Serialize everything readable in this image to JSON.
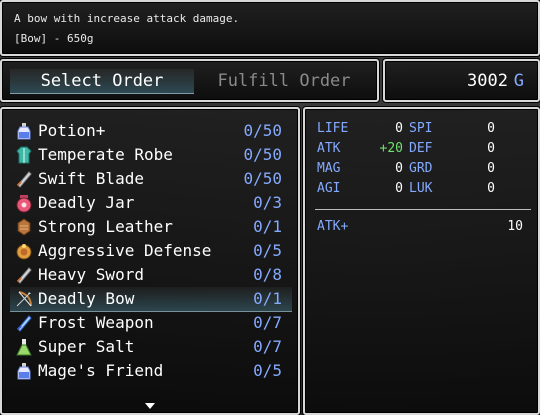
{
  "help": {
    "line1": "A bow with increase attack damage.",
    "line2": "[Bow] - 650g"
  },
  "commands": {
    "select_order": "Select Order",
    "fulfill_order": "Fulfill Order"
  },
  "gold": {
    "value": "3002",
    "unit": "G"
  },
  "items": [
    {
      "name": "Potion+",
      "qty": "0/50",
      "icon": "potion-icon"
    },
    {
      "name": "Temperate Robe",
      "qty": "0/50",
      "icon": "robe-icon"
    },
    {
      "name": "Swift Blade",
      "qty": "0/50",
      "icon": "sword-icon"
    },
    {
      "name": "Deadly Jar",
      "qty": "0/3",
      "icon": "jar-icon"
    },
    {
      "name": "Strong Leather",
      "qty": "0/1",
      "icon": "leather-icon"
    },
    {
      "name": "Aggressive Defense",
      "qty": "0/5",
      "icon": "ring-icon"
    },
    {
      "name": "Heavy Sword",
      "qty": "0/8",
      "icon": "sword-icon"
    },
    {
      "name": "Deadly Bow",
      "qty": "0/1",
      "icon": "bow-icon"
    },
    {
      "name": "Frost Weapon",
      "qty": "0/7",
      "icon": "frost-sword-icon"
    },
    {
      "name": "Super Salt",
      "qty": "0/7",
      "icon": "flask-icon"
    },
    {
      "name": "Mage's Friend",
      "qty": "0/5",
      "icon": "potion-icon"
    }
  ],
  "selected_index": 7,
  "stats": {
    "life": {
      "label": "LIFE",
      "value": "0"
    },
    "atk": {
      "label": "ATK",
      "value": "+20"
    },
    "mag": {
      "label": "MAG",
      "value": "0"
    },
    "agi": {
      "label": "AGI",
      "value": "0"
    },
    "spi": {
      "label": "SPI",
      "value": "0"
    },
    "def": {
      "label": "DEF",
      "value": "0"
    },
    "grd": {
      "label": "GRD",
      "value": "0"
    },
    "luk": {
      "label": "LUK",
      "value": "0"
    },
    "atk_plus": {
      "label": "ATK+",
      "value": "10"
    }
  },
  "colors": {
    "accent": "#84aaff",
    "increase": "#70e070"
  }
}
